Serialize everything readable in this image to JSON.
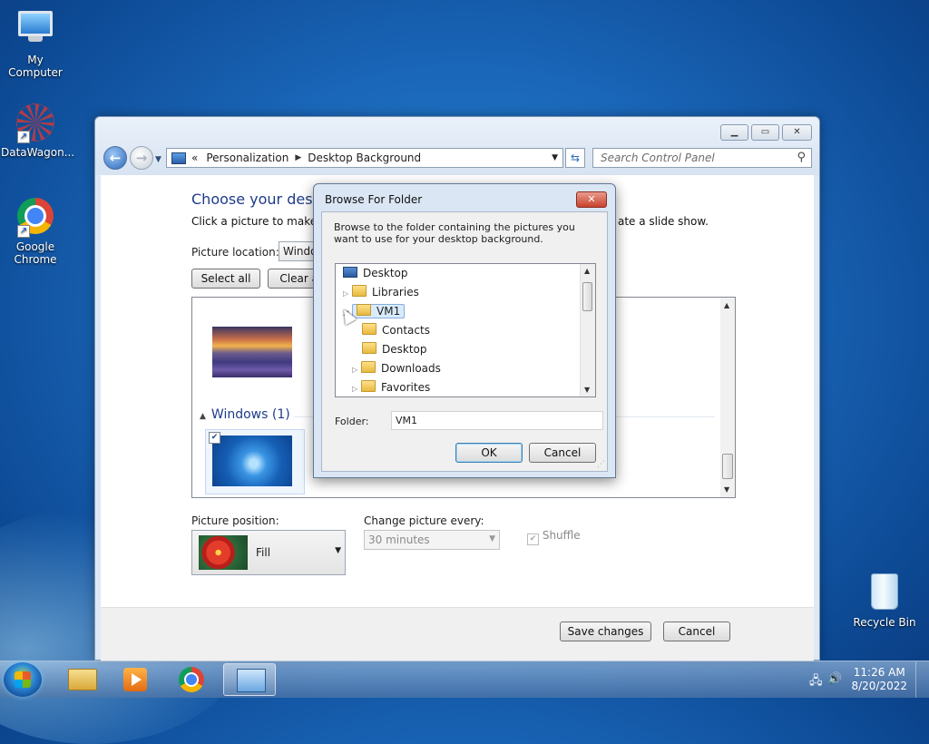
{
  "desktop": {
    "icons": [
      {
        "label": "My Computer"
      },
      {
        "label": "DataWagon..."
      },
      {
        "label": "Google Chrome"
      },
      {
        "label": "Recycle Bin"
      }
    ]
  },
  "window": {
    "address": {
      "prefix": "«",
      "crumbs": [
        "Personalization",
        "Desktop Background"
      ]
    },
    "search_placeholder": "Search Control Panel",
    "title": "Choose your desktop",
    "subtitle": "Click a picture to make it y",
    "subtitle_tail": "ate a slide show.",
    "picture_location_label": "Picture location:",
    "picture_location_value": "Windows",
    "select_all": "Select all",
    "clear_all": "Clear all",
    "group_header": "Windows (1)",
    "picture_position_label": "Picture position:",
    "position_value": "Fill",
    "change_every_label": "Change picture every:",
    "change_every_value": "30 minutes",
    "shuffle_label": "Shuffle",
    "save_button": "Save changes",
    "cancel_button": "Cancel"
  },
  "dialog": {
    "title": "Browse For Folder",
    "instruction": "Browse to the folder containing the pictures you want to use for your desktop background.",
    "tree": [
      {
        "label": "Desktop"
      },
      {
        "label": "Libraries"
      },
      {
        "label": "VM1"
      },
      {
        "label": "Contacts"
      },
      {
        "label": "Desktop"
      },
      {
        "label": "Downloads"
      },
      {
        "label": "Favorites"
      }
    ],
    "folder_label": "Folder:",
    "folder_value": "VM1",
    "ok": "OK",
    "cancel": "Cancel"
  },
  "taskbar": {
    "time": "11:26 AM",
    "date": "8/20/2022"
  }
}
